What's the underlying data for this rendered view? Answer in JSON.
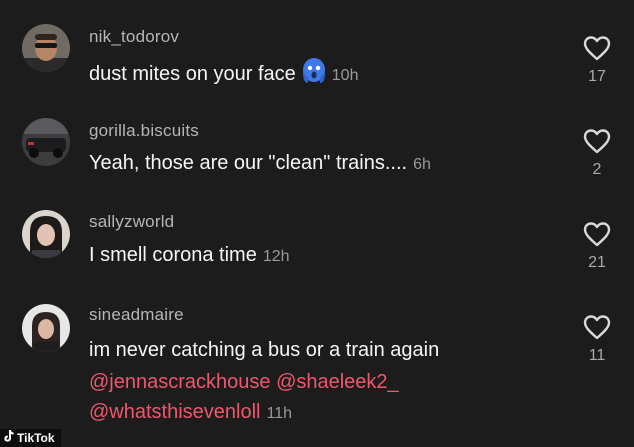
{
  "comments": [
    {
      "username": "nik_todorov",
      "text": "dust mites on your face",
      "emoji": "face-screaming-emoji",
      "time": "10h",
      "likes": "17"
    },
    {
      "username": "gorilla.biscuits",
      "text": "Yeah, those are our \"clean\" trains....",
      "time": "6h",
      "likes": "2"
    },
    {
      "username": "sallyzworld",
      "text": "I smell corona time",
      "time": "12h",
      "likes": "21"
    },
    {
      "username": "sineadmaire",
      "text": "im never catching a bus or a train again",
      "mentions_line1": "@jennascrackhouse @shaeleek2_",
      "mentions_line2": "@whatsthisevenloll",
      "time": "11h",
      "likes": "11"
    }
  ],
  "watermark": "TikTok",
  "icons": {
    "like": "heart-outline-icon",
    "watermark_logo": "tiktok-note-icon"
  },
  "colors": {
    "background": "#1c1c1c",
    "mention": "#f0566d",
    "username": "#b6b6b6"
  }
}
